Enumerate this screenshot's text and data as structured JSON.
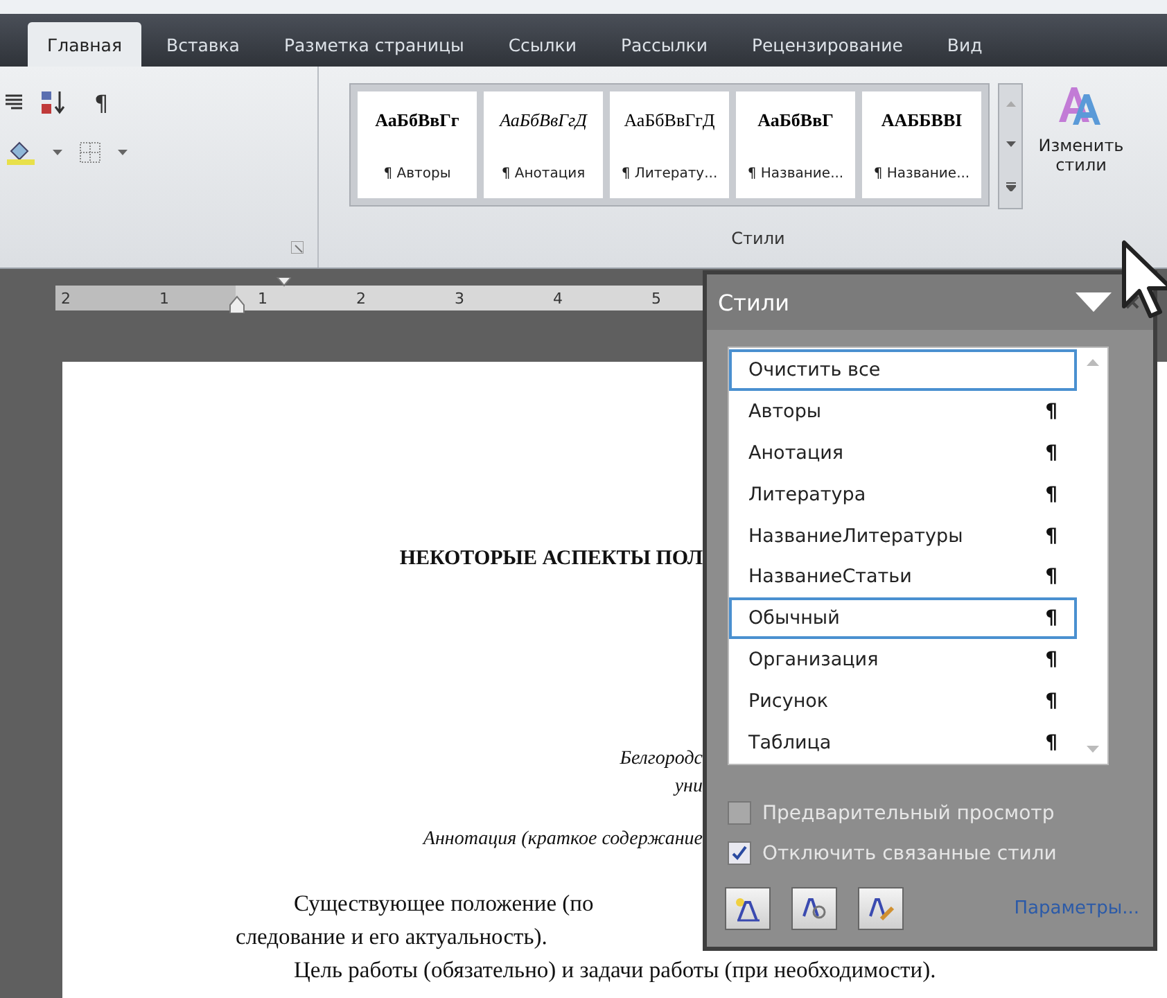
{
  "tabs": [
    {
      "label": "Главная",
      "selected": true
    },
    {
      "label": "Вставка",
      "selected": false
    },
    {
      "label": "Разметка страницы",
      "selected": false
    },
    {
      "label": "Ссылки",
      "selected": false
    },
    {
      "label": "Рассылки",
      "selected": false
    },
    {
      "label": "Рецензирование",
      "selected": false
    },
    {
      "label": "Вид",
      "selected": false
    }
  ],
  "ribbon": {
    "paragraph_mark": "¶",
    "style_gallery": [
      {
        "sample": "АаБбВвГг",
        "kind": "bold",
        "label": "¶ Авторы"
      },
      {
        "sample": "АаБбВвГгД",
        "kind": "italic",
        "label": "¶ Анотация"
      },
      {
        "sample": "АаБбВвГгД",
        "kind": "normal",
        "label": "¶ Литерату..."
      },
      {
        "sample": "АаБбВвГ",
        "kind": "bold",
        "label": "¶ Название..."
      },
      {
        "sample": "ААББВВI",
        "kind": "bold",
        "label": "¶ Название..."
      }
    ],
    "change_styles": {
      "label": "Изменить стили"
    },
    "group_label": "Стили"
  },
  "ruler": {
    "labels": [
      "2",
      "1",
      "1",
      "2",
      "3",
      "4",
      "5"
    ]
  },
  "document": {
    "lines": [
      {
        "kind": "heading",
        "text": "НЕКОТОРЫЕ АСПЕКТЫ ПОЛ"
      },
      {
        "kind": "affiliation",
        "text": "Белгородс"
      },
      {
        "kind": "affiliation",
        "text": "уни"
      },
      {
        "kind": "abstract",
        "text": "Аннотация (краткое содержание"
      },
      {
        "kind": "indent",
        "text": "Существующее положение (по"
      },
      {
        "kind": "plain",
        "text": "следование и его актуальность)."
      },
      {
        "kind": "indent",
        "text": "Цель работы (обязательно) и задачи работы (при необходимости)."
      }
    ]
  },
  "styles_pane": {
    "title": "Стили",
    "items": [
      {
        "name": "Очистить все",
        "selected": true
      },
      {
        "name": "Авторы",
        "mark": "¶",
        "selected": false
      },
      {
        "name": "Анотация",
        "mark": "¶",
        "selected": false
      },
      {
        "name": "Литература",
        "mark": "¶",
        "selected": false
      },
      {
        "name": "НазваниеЛитературы",
        "mark": "¶",
        "selected": false
      },
      {
        "name": "НазваниеСтатьи",
        "mark": "¶",
        "selected": false
      },
      {
        "name": "Обычный",
        "mark": "¶",
        "selected": true
      },
      {
        "name": "Организация",
        "mark": "¶",
        "selected": false
      },
      {
        "name": "Рисунок",
        "mark": "¶",
        "selected": false
      },
      {
        "name": "Таблица",
        "mark": "¶",
        "selected": false
      }
    ],
    "options": [
      {
        "label": "Предварительный просмотр",
        "checked": false
      },
      {
        "label": "Отключить связанные стили",
        "checked": true
      }
    ],
    "link": "Параметры..."
  }
}
